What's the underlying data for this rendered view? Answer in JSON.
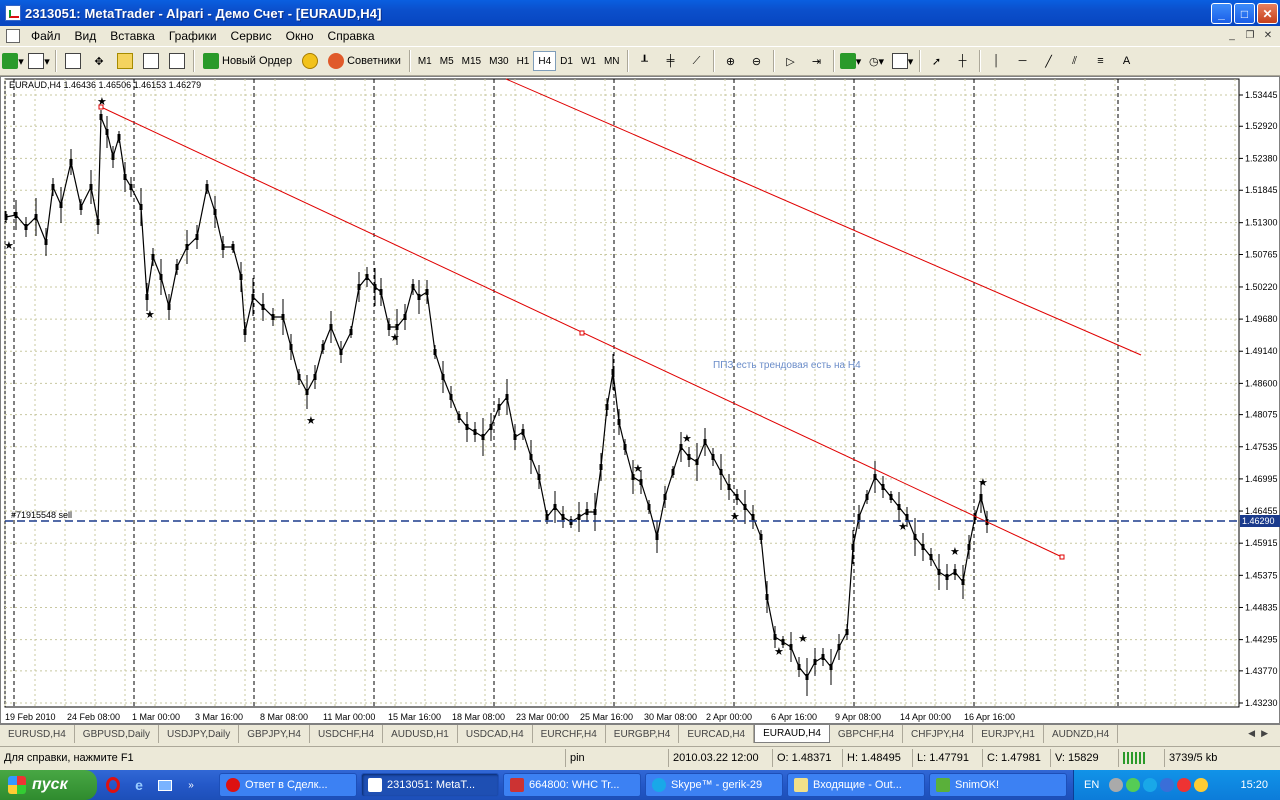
{
  "window": {
    "title": "2313051: MetaTrader - Alpari - Демо Счет - [EURAUD,H4]"
  },
  "menu": [
    "Файл",
    "Вид",
    "Вставка",
    "Графики",
    "Сервис",
    "Окно",
    "Справка"
  ],
  "toolbar": {
    "new_order": "Новый Ордер",
    "advisors": "Советники",
    "timeframes": [
      "M1",
      "M5",
      "M15",
      "M30",
      "H1",
      "H4",
      "D1",
      "W1",
      "MN"
    ],
    "active_timeframe": "H4"
  },
  "chart": {
    "symbol_header": "EURAUD,H4  1.46436 1.46506 1.46153 1.46279",
    "order_label": "#71915548 sell",
    "annotation": "ППЗ есть трендовая есть на Н4",
    "current_price": "1.46290",
    "price_levels": [
      "1.53445",
      "1.52920",
      "1.52380",
      "1.51845",
      "1.51300",
      "1.50765",
      "1.50220",
      "1.49680",
      "1.49140",
      "1.48600",
      "1.48075",
      "1.47535",
      "1.46995",
      "1.46455",
      "1.45915",
      "1.45375",
      "1.44835",
      "1.44295",
      "1.43770",
      "1.43230"
    ],
    "date_labels": [
      "19 Feb 2010",
      "24 Feb 08:00",
      "1 Mar 00:00",
      "3 Mar 16:00",
      "8 Mar 08:00",
      "11 Mar 00:00",
      "15 Mar 16:00",
      "18 Mar 08:00",
      "23 Mar 00:00",
      "25 Mar 16:00",
      "30 Mar 08:00",
      "2 Apr 00:00",
      "6 Apr 16:00",
      "9 Apr 08:00",
      "14 Apr 00:00",
      "16 Apr 16:00"
    ],
    "colors": {
      "trendline": "#E00000",
      "order_line": "#1A3A8C",
      "candle": "#000000",
      "grid": "#C8C8A0",
      "price_tag": "#1A3A8C"
    }
  },
  "tabs": {
    "items": [
      "EURUSD,H4",
      "GBPUSD,Daily",
      "USDJPY,Daily",
      "GBPJPY,H4",
      "USDCHF,H4",
      "AUDUSD,H1",
      "USDCAD,H4",
      "EURCHF,H4",
      "EURGBP,H4",
      "EURCAD,H4",
      "EURAUD,H4",
      "GBPCHF,H4",
      "CHFJPY,H4",
      "EURJPY,H1",
      "AUDNZD,H4"
    ],
    "active": "EURAUD,H4"
  },
  "status": {
    "help": "Для справки, нажмите F1",
    "profile": "pin",
    "time": "2010.03.22 12:00",
    "open": "O: 1.48371",
    "high": "H: 1.48495",
    "low": "L: 1.47791",
    "close": "C: 1.47981",
    "volume": "V: 15829",
    "traffic": "3739/5 kb"
  },
  "taskbar": {
    "start": "пуск",
    "tasks": [
      "Ответ в Сделк...",
      "2313051: MetaT...",
      "664800: WHC Tr...",
      "Skype™ - gerik-29",
      "Входящие - Out...",
      "SnimOK!"
    ],
    "lang": "EN",
    "clock": "15:20"
  }
}
